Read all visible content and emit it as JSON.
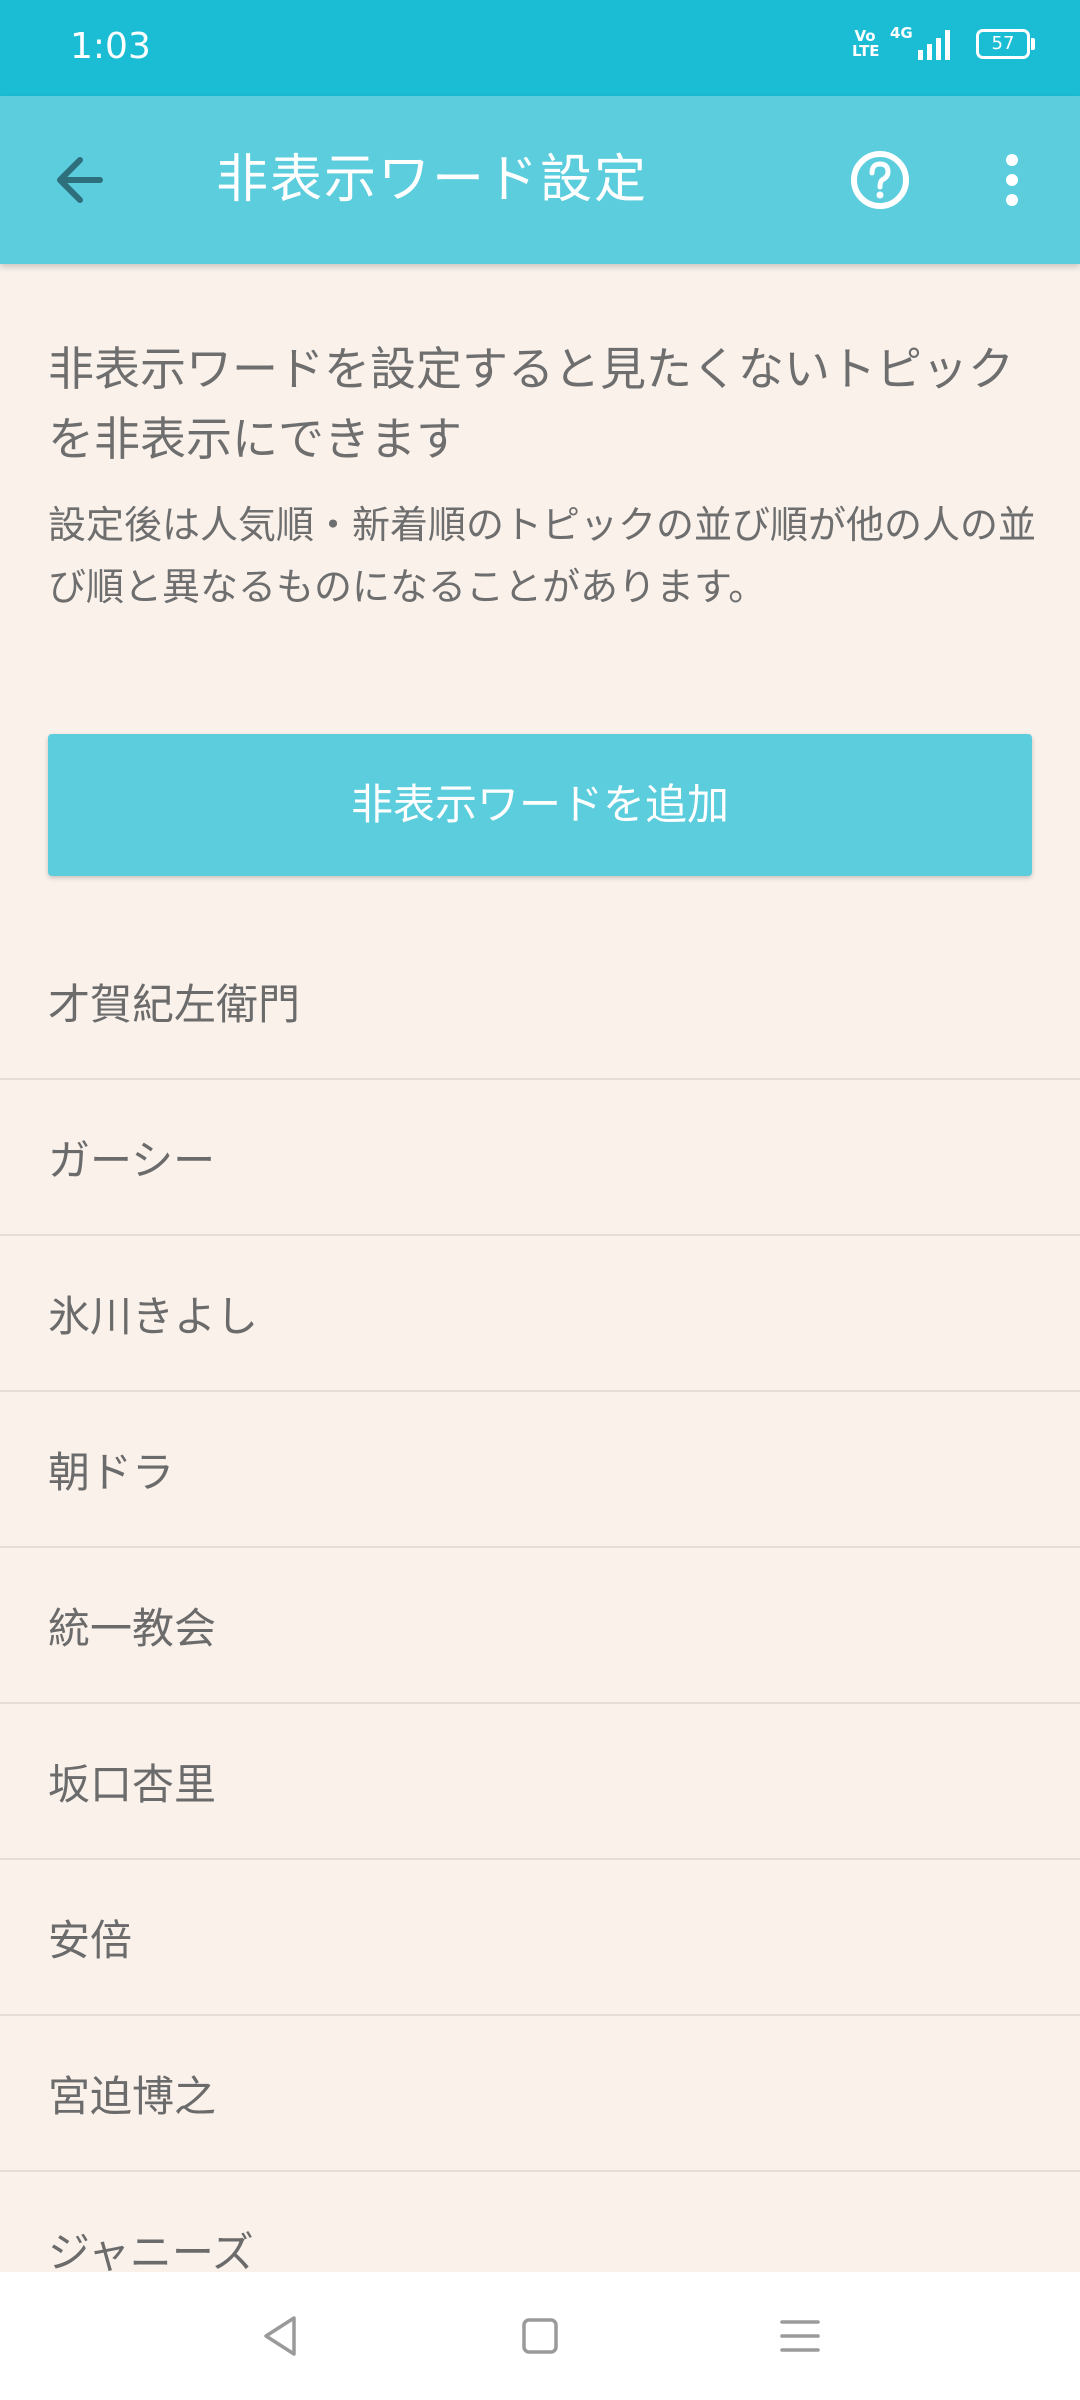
{
  "status_bar": {
    "time": "1:03",
    "volte": "Vo\nLTE",
    "network": "4G",
    "battery": "57"
  },
  "app_bar": {
    "title": "非表示ワード設定",
    "icons": [
      "back-arrow-icon",
      "help-circle-icon",
      "more-vertical-icon"
    ]
  },
  "intro": {
    "headline": "非表示ワードを設定すると見たくないトピックを非表示にできます",
    "note": "設定後は人気順・新着順のトピックの並び順が他の人の並び順と異なるものになることがあります。"
  },
  "add_button_label": "非表示ワードを追加",
  "hidden_words": [
    "才賀紀左衛門",
    "ガーシー",
    "氷川きよし",
    "朝ドラ",
    "統一教会",
    "坂口杏里",
    "安倍",
    "宮迫博之",
    "ジャニーズ"
  ],
  "nav_bar": {
    "icons": [
      "back-triangle-icon",
      "home-square-icon",
      "menu-lines-icon"
    ]
  },
  "colors": {
    "status_bar": "#1bbdd4",
    "app_bar": "#5bcddd",
    "background": "#faf1eb",
    "accent_button": "#5bcddd"
  }
}
